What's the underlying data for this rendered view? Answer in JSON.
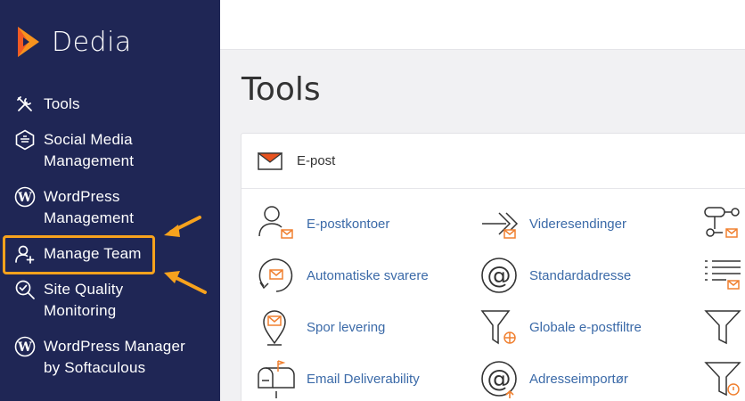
{
  "brand": {
    "name": "Dedia"
  },
  "sidebar": {
    "items": [
      {
        "label": "Tools"
      },
      {
        "label": "Social Media Management"
      },
      {
        "label": "WordPress Management"
      },
      {
        "label": "Manage Team"
      },
      {
        "label": "Site Quality Monitoring"
      },
      {
        "label": "WordPress Manager by Softaculous"
      }
    ],
    "highlighted_item": "Manage Team"
  },
  "page": {
    "title": "Tools"
  },
  "panel": {
    "title": "E-post",
    "tools": [
      {
        "label": "E-postkontoer",
        "icon": "user-mail-icon"
      },
      {
        "label": "Videresendinger",
        "icon": "forward-mail-icon"
      },
      {
        "label": "Automatiske svarere",
        "icon": "autoresponder-icon"
      },
      {
        "label": "Standardadresse",
        "icon": "at-sign-icon"
      },
      {
        "label": "Spor levering",
        "icon": "track-delivery-icon"
      },
      {
        "label": "Globale e-postfiltre",
        "icon": "global-filter-icon"
      },
      {
        "label": "Email Deliverability",
        "icon": "mailbox-icon"
      },
      {
        "label": "Adresseimportør",
        "icon": "address-importer-icon"
      }
    ]
  },
  "colors": {
    "sidebar_bg": "#1f2655",
    "accent": "#f7a21d",
    "link": "#3b6aa8"
  }
}
